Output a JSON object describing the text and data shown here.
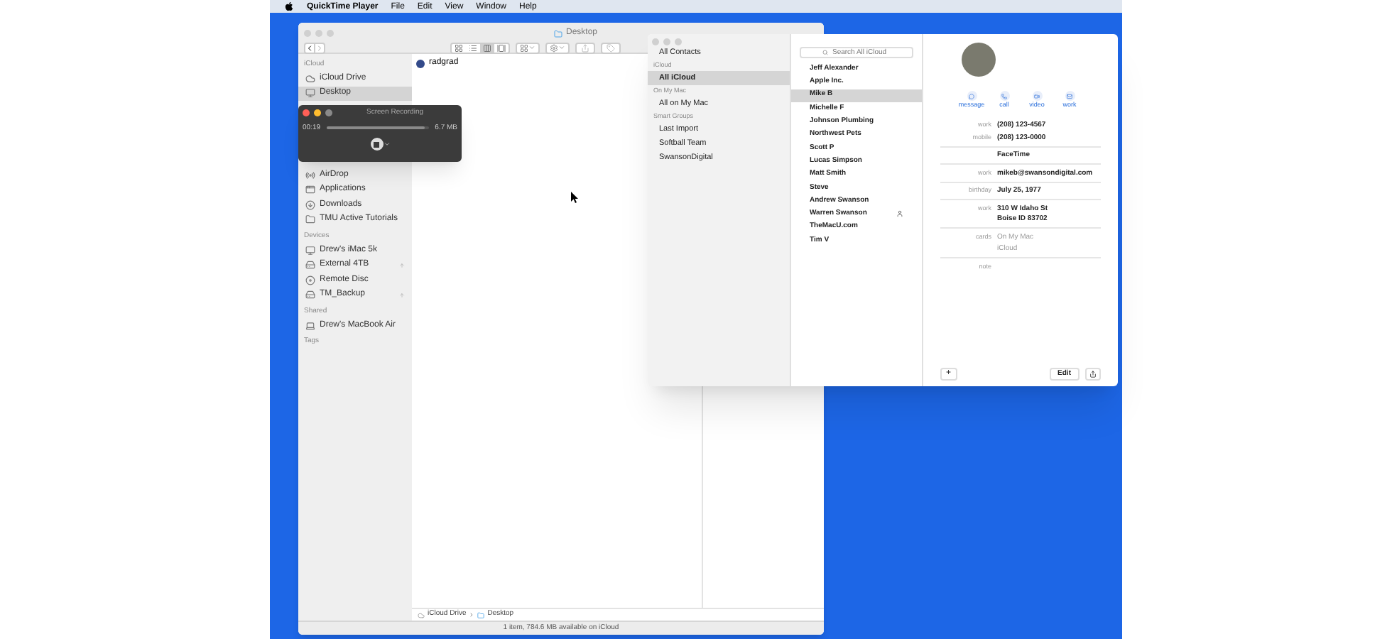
{
  "menu_bar": {
    "app": "QuickTime Player",
    "items": [
      "File",
      "Edit",
      "View",
      "Window",
      "Help"
    ]
  },
  "finder": {
    "title": "Desktop",
    "view_modes": [
      {
        "kind": "icons",
        "selected": false
      },
      {
        "kind": "list",
        "selected": false
      },
      {
        "kind": "columns",
        "selected": true
      },
      {
        "kind": "gallery",
        "selected": false
      }
    ],
    "sidebar": [
      {
        "heading": "iCloud",
        "items": [
          {
            "label": "iCloud Drive",
            "kind": "cloud",
            "selected": false,
            "eject": false
          },
          {
            "label": "Desktop",
            "kind": "desktop",
            "selected": true,
            "eject": false
          }
        ]
      },
      {
        "items": [
          {
            "label": "AirDrop",
            "kind": "airdrop",
            "selected": false,
            "eject": false
          },
          {
            "label": "Applications",
            "kind": "apps",
            "selected": false,
            "eject": false
          },
          {
            "label": "Downloads",
            "kind": "downloads",
            "selected": false,
            "eject": false
          },
          {
            "label": "TMU Active Tutorials",
            "kind": "folder",
            "selected": false,
            "eject": false
          }
        ]
      },
      {
        "heading": "Devices",
        "items": [
          {
            "label": "Drew's iMac 5k",
            "kind": "imac",
            "selected": false,
            "eject": false
          },
          {
            "label": "External 4TB",
            "kind": "drive",
            "selected": false,
            "eject": true
          },
          {
            "label": "Remote Disc",
            "kind": "disc",
            "selected": false,
            "eject": false
          },
          {
            "label": "TM_Backup",
            "kind": "drive",
            "selected": false,
            "eject": true
          }
        ]
      },
      {
        "heading": "Shared",
        "items": [
          {
            "label": "Drew's MacBook Air",
            "kind": "laptop",
            "selected": false,
            "eject": false
          }
        ]
      },
      {
        "heading": "Tags"
      }
    ],
    "files": [
      {
        "name": "radgrad"
      }
    ],
    "path_bar": [
      "iCloud Drive",
      "Desktop"
    ],
    "status_bar": "1 item, 784.6 MB available on iCloud"
  },
  "recording": {
    "title": "Screen Recording",
    "time": "00:19",
    "size": "6.7 MB",
    "level": 0.96
  },
  "contacts": {
    "groups": [
      {
        "items": [
          {
            "label": "All Contacts",
            "selected": false
          }
        ]
      },
      {
        "heading": "iCloud",
        "items": [
          {
            "label": "All iCloud",
            "selected": true
          }
        ]
      },
      {
        "heading": "On My Mac",
        "items": [
          {
            "label": "All on My Mac",
            "selected": false
          }
        ]
      },
      {
        "heading": "Smart Groups",
        "items": [
          {
            "label": "Last Import",
            "selected": false
          },
          {
            "label": "Softball Team",
            "selected": false
          },
          {
            "label": "SwansonDigital",
            "selected": false
          }
        ]
      }
    ],
    "search": {
      "placeholder": "Search All iCloud"
    },
    "list": [
      {
        "name": "Jeff Alexander",
        "selected": false,
        "me": false
      },
      {
        "name": "Apple Inc.",
        "selected": false,
        "me": false
      },
      {
        "name": "Mike B",
        "selected": true,
        "me": false
      },
      {
        "name": "Michelle F",
        "selected": false,
        "me": false
      },
      {
        "name": "Johnson Plumbing",
        "selected": false,
        "me": false
      },
      {
        "name": "Northwest Pets",
        "selected": false,
        "me": false
      },
      {
        "name": "Scott P",
        "selected": false,
        "me": false
      },
      {
        "name": "Lucas Simpson",
        "selected": false,
        "me": false
      },
      {
        "name": "Matt Smith",
        "selected": false,
        "me": false
      },
      {
        "name": "Steve",
        "selected": false,
        "me": false
      },
      {
        "name": "Andrew Swanson",
        "selected": false,
        "me": false
      },
      {
        "name": "Warren Swanson",
        "selected": false,
        "me": true
      },
      {
        "name": "TheMacU.com",
        "selected": false,
        "me": false
      },
      {
        "name": "Tim V",
        "selected": false,
        "me": false
      }
    ],
    "actions": [
      {
        "kind": "message",
        "label": "message"
      },
      {
        "kind": "call",
        "label": "call"
      },
      {
        "kind": "video",
        "label": "video"
      },
      {
        "kind": "mail",
        "label": "work"
      }
    ],
    "field_groups": [
      [
        {
          "label": "work",
          "value": "(208) 123-4567",
          "muted": false
        },
        {
          "label": "mobile",
          "value": "(208) 123-0000",
          "muted": false
        }
      ],
      [
        {
          "value": "FaceTime",
          "muted": false
        }
      ],
      [
        {
          "label": "work",
          "value": "mikeb@swansondigital.com",
          "muted": false
        }
      ],
      [
        {
          "label": "birthday",
          "value": "July 25, 1977",
          "muted": false
        }
      ],
      [
        {
          "label": "work",
          "value": "310 W Idaho St\nBoise ID 83702",
          "muted": false
        }
      ],
      [
        {
          "label": "cards",
          "value": "On My Mac",
          "muted": true
        },
        {
          "value": "iCloud",
          "muted": true
        }
      ],
      [
        {
          "label": "note"
        }
      ]
    ],
    "add_button": "+",
    "edit_button": "Edit"
  }
}
